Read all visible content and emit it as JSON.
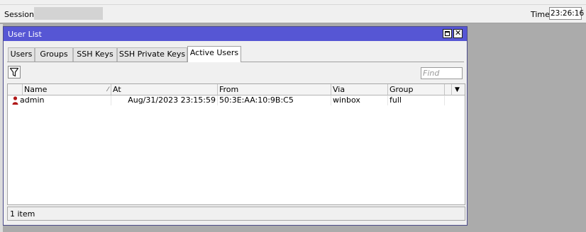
{
  "header": {
    "session_label": "Session:",
    "session_value": "",
    "time_label": "Time:",
    "time_value": "23:26:16"
  },
  "window": {
    "title": "User List",
    "tabs": [
      {
        "label": "Users"
      },
      {
        "label": "Groups"
      },
      {
        "label": "SSH Keys"
      },
      {
        "label": "SSH Private Keys"
      },
      {
        "label": "Active Users",
        "active": true
      }
    ],
    "toolbar": {
      "filter_icon": "filter-funnel-icon",
      "find_placeholder": "Find"
    },
    "table": {
      "columns": [
        "Name",
        "At",
        "From",
        "Via",
        "Group"
      ],
      "sorted_column": "Name",
      "rows": [
        {
          "icon": "active-user-icon",
          "name": "admin",
          "at": "Aug/31/2023 23:15:59",
          "from": "50:3E:AA:10:9B:C5",
          "via": "winbox",
          "group": "full"
        }
      ]
    },
    "status": "1 item"
  },
  "colors": {
    "titlebar": "#5656d4",
    "desktop": "#ababab",
    "user_icon": "#b01818"
  }
}
